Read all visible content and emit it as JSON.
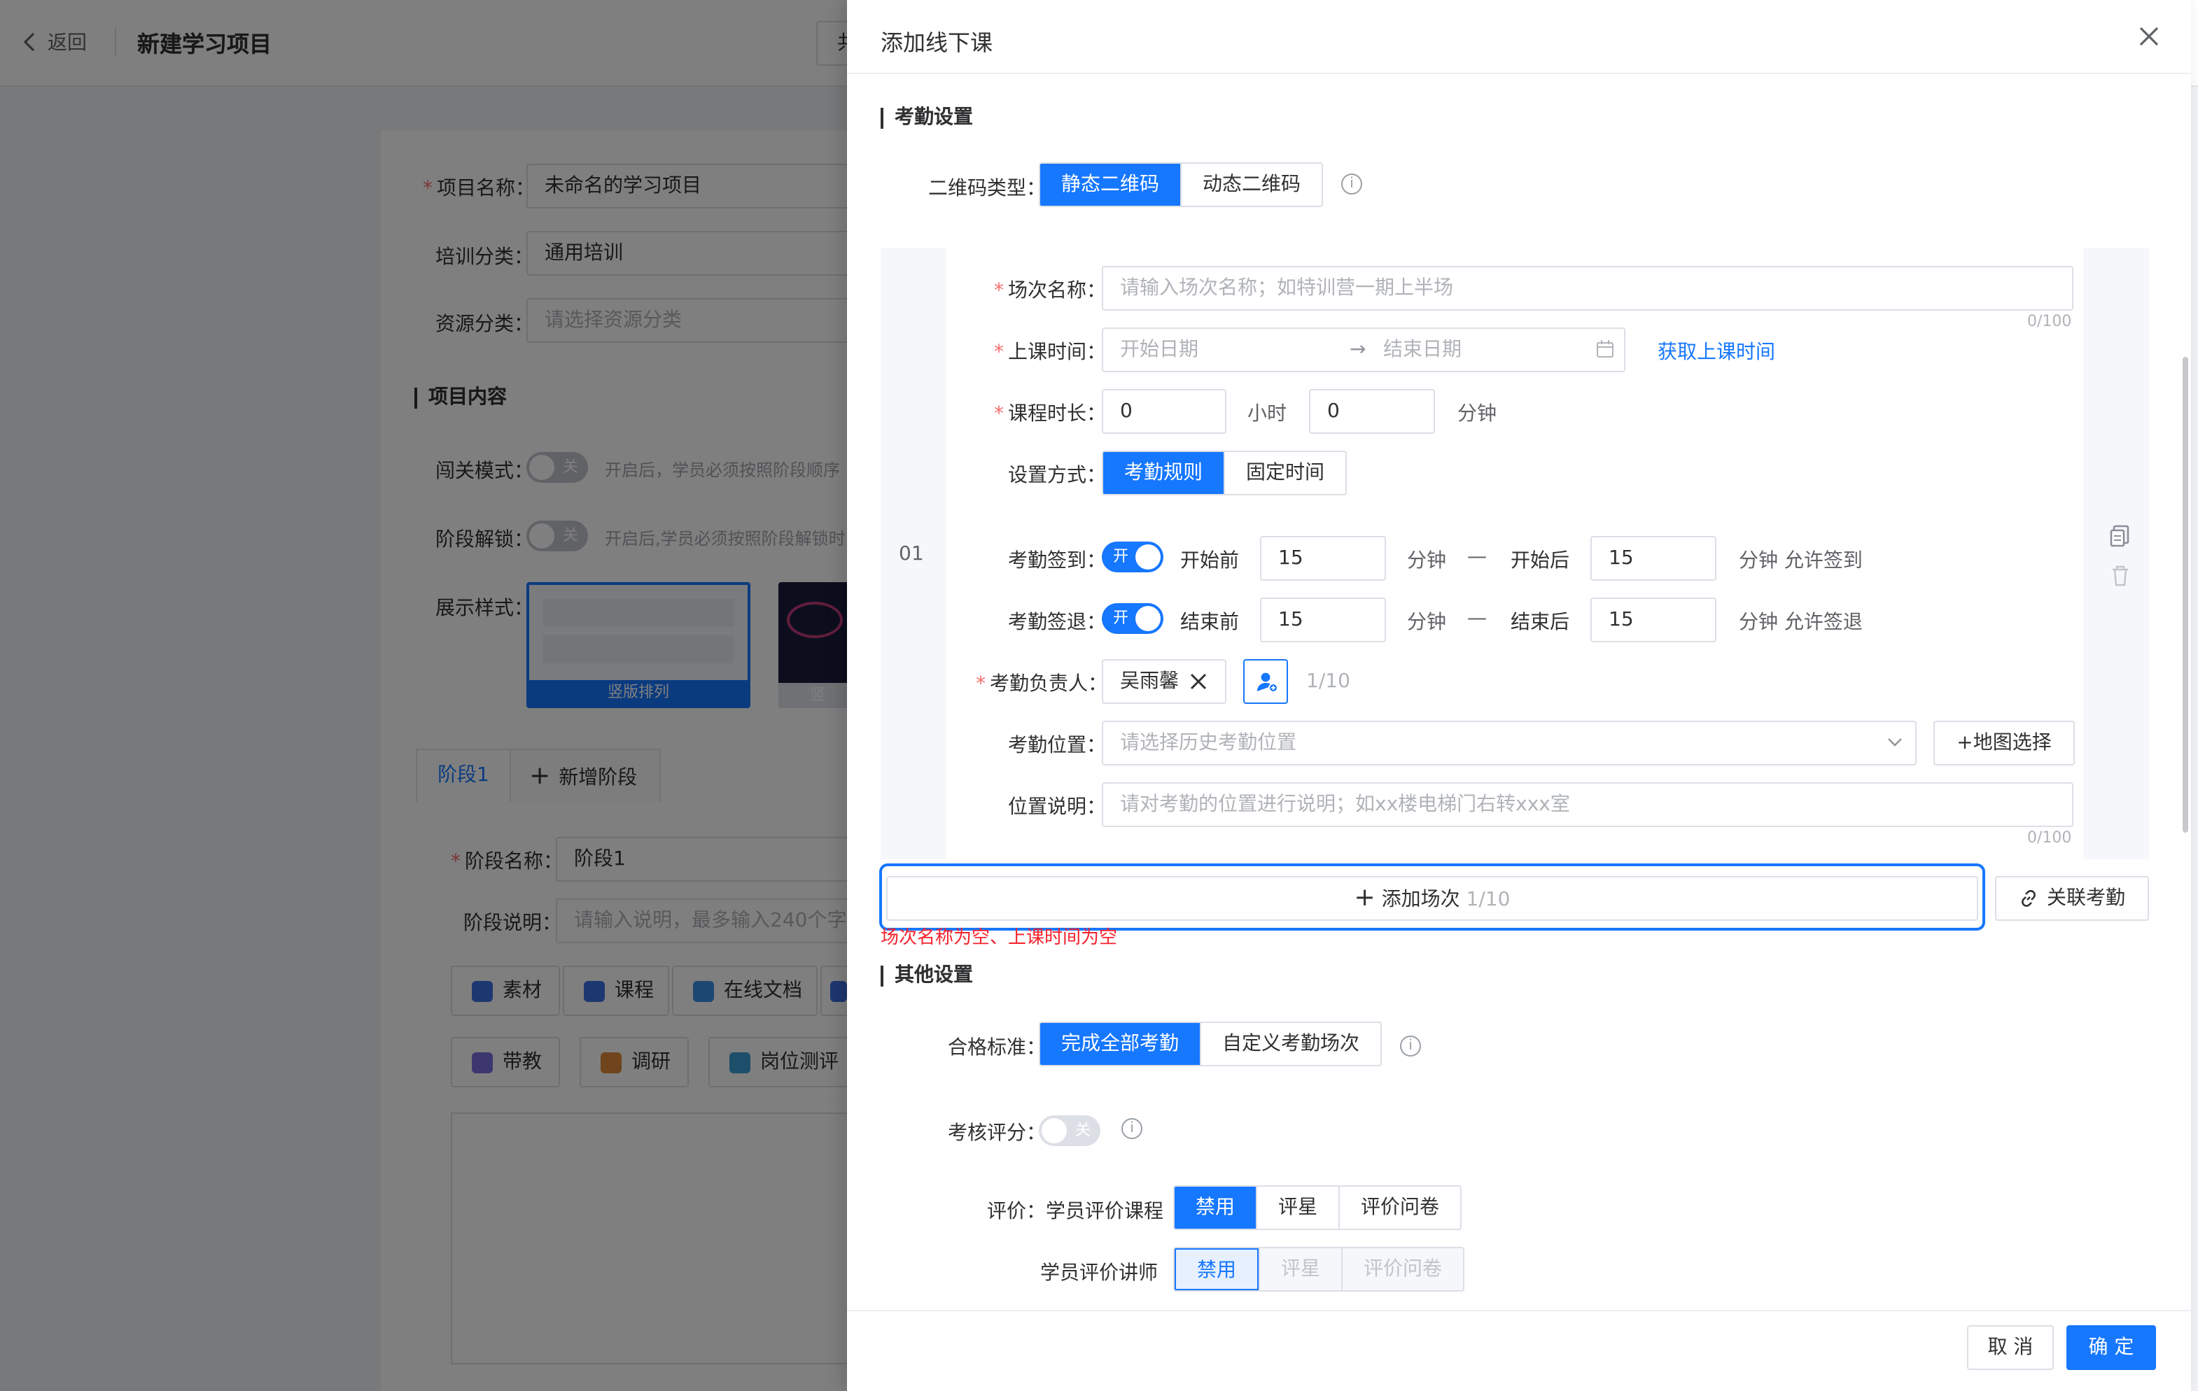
{
  "bg": {
    "back_label": "返回",
    "page_title": "新建学习项目",
    "top_btn_fragment": "共",
    "fields": [
      {
        "label": "项目名称：",
        "value": "未命名的学习项目",
        "required": true
      },
      {
        "label": "培训分类：",
        "value": "通用培训",
        "required": false
      },
      {
        "label": "资源分类：",
        "value": "请选择资源分类",
        "required": false
      }
    ],
    "project_content_title": "项目内容",
    "levelup_label": "闯关模式：",
    "levelup_switch": "关",
    "levelup_hint": "开启后，学员必须按照阶段顺序",
    "stage_unlock_label": "阶段解锁：",
    "stage_unlock_switch": "关",
    "stage_unlock_hint": "开启后,学员必须按照阶段解锁时",
    "display_label": "展示样式：",
    "display_option_1": "竖版排列",
    "display_option_2": "竖",
    "stage_tab": "阶段1",
    "add_stage": "新增阶段",
    "stage_name_label": "阶段名称：",
    "stage_name_value": "阶段1",
    "stage_desc_label": "阶段说明：",
    "stage_desc_placeholder": "请输入说明，最多输入240个字",
    "chips": [
      "素材",
      "课程",
      "在线文档",
      "带教",
      "调研",
      "岗位测评"
    ]
  },
  "drawer": {
    "title": "添加线下课",
    "attendance_title": "考勤设置",
    "qr_label": "二维码类型：",
    "qr_options": [
      "静态二维码",
      "动态二维码"
    ],
    "session": {
      "index": "01",
      "name_label": "场次名称：",
      "name_placeholder": "请输入场次名称；如特训营一期上半场",
      "name_count": "0/100",
      "time_label": "上课时间：",
      "start_placeholder": "开始日期",
      "end_placeholder": "结束日期",
      "get_time_link": "获取上课时间",
      "duration_label": "课程时长：",
      "hours_value": "0",
      "hours_unit": "小时",
      "minutes_value": "0",
      "minutes_unit": "分钟",
      "mode_label": "设置方式：",
      "mode_options": [
        "考勤规则",
        "固定时间"
      ],
      "checkin_label": "考勤签到：",
      "checkin_switch": "开",
      "checkin_before": "开始前",
      "checkin_before_value": "15",
      "checkin_after": "开始后",
      "checkin_after_value": "15",
      "checkin_tail": "分钟 允许签到",
      "checkout_label": "考勤签退：",
      "checkout_switch": "开",
      "checkout_before": "结束前",
      "checkout_before_value": "15",
      "checkout_after": "结束后",
      "checkout_after_value": "15",
      "checkout_tail": "分钟 允许签退",
      "minute": "分钟",
      "dash": "—",
      "owner_label": "考勤负责人：",
      "owner_name": "吴雨馨",
      "owner_count": "1/10",
      "location_label": "考勤位置：",
      "location_placeholder": "请选择历史考勤位置",
      "map_button": "+地图选择",
      "desc_label": "位置说明：",
      "desc_placeholder": "请对考勤的位置进行说明；如xx楼电梯门右转xxx室",
      "desc_count": "0/100"
    },
    "add_session": "添加场次",
    "add_session_count": "1/10",
    "link_attendance": "关联考勤",
    "error_text": "场次名称为空、上课时间为空",
    "other_title": "其他设置",
    "pass_label": "合格标准：",
    "pass_options": [
      "完成全部考勤",
      "自定义考勤场次"
    ],
    "score_label": "考核评分：",
    "score_switch": "关",
    "eval_label": "评价：",
    "eval_course_label": "学员评价课程",
    "eval_course_options": [
      "禁用",
      "评星",
      "评价问卷"
    ],
    "eval_teacher_label": "学员评价讲师",
    "eval_teacher_options": [
      "禁用",
      "评星",
      "评价问卷"
    ],
    "cancel": "取 消",
    "confirm": "确 定"
  }
}
